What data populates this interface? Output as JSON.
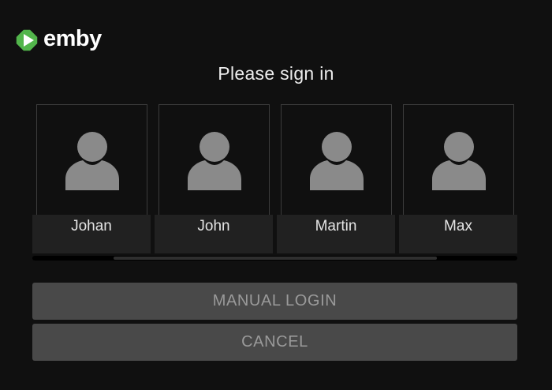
{
  "brand": {
    "name": "emby",
    "accent": "#52b54b",
    "icon": "emby-logo-icon"
  },
  "title": "Please sign in",
  "users": [
    {
      "name": "Johan",
      "icon": "user-avatar-icon"
    },
    {
      "name": "John",
      "icon": "user-avatar-icon"
    },
    {
      "name": "Martin",
      "icon": "user-avatar-icon"
    },
    {
      "name": "Max",
      "icon": "user-avatar-icon"
    }
  ],
  "buttons": {
    "manual_login": "MANUAL LOGIN",
    "cancel": "CANCEL"
  },
  "colors": {
    "background": "#101010",
    "card_footer": "#212121",
    "button": "#494949",
    "button_text": "#9a9a9a",
    "avatar": "#8a8a8a"
  }
}
